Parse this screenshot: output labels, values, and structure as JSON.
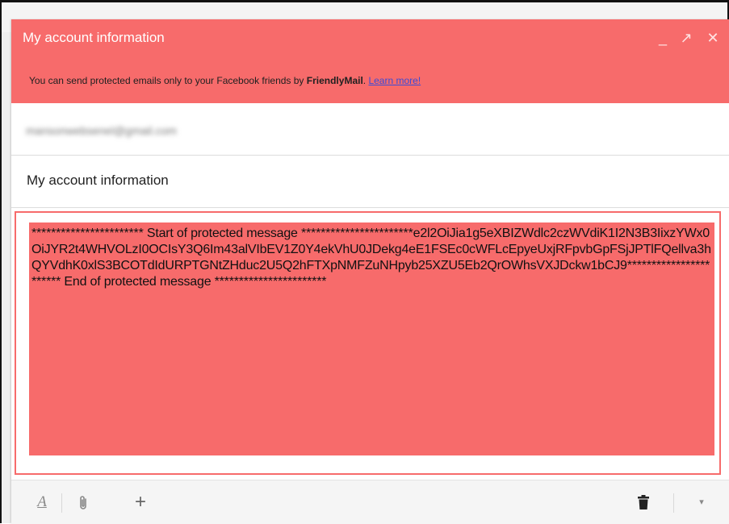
{
  "window": {
    "title": "My account information",
    "minimize_icon": "minimize-icon",
    "expand_icon": "expand-icon",
    "close_icon": "close-icon",
    "minimize_glyph": "_",
    "expand_glyph": "↗",
    "close_glyph": "✕"
  },
  "notice": {
    "text_before": "You can send protected emails only to your Facebook friends by ",
    "brand": "FriendlyMail",
    "text_after": ". ",
    "link": "Learn more!"
  },
  "recipients": {
    "value": "mansonwebsenel@gmail.com"
  },
  "subject": {
    "value": "My account information"
  },
  "body": {
    "protected_message": "*********************** Start of protected message ***********************e2l2OiJia1g5eXBIZWdlc2czWVdiK1I2N3B3IixzYWx0OiJYR2t4WHVOLzI0OCIsY3Q6Im43alVIbEV1Z0Y4ekVhU0JDekg4eE1FSEc0cWFLcEpyeUxjRFpvbGpFSjJPTlFQellva3hQYVdhK0xlS3BCOTdIdURPTGNtZHduc2U5Q2hFTXpNMFZuNHpyb25XZU5Eb2QrOWhsVXJDckw1bCJ9*********************** End of protected message ***********************"
  },
  "toolbar": {
    "format_glyph": "A",
    "attach_glyph": "📎",
    "plus_glyph": "+",
    "more_glyph": "▾",
    "icons": [
      "formatting-icon",
      "attach-icon",
      "plus-icon",
      "trash-icon",
      "more-options-icon"
    ]
  }
}
